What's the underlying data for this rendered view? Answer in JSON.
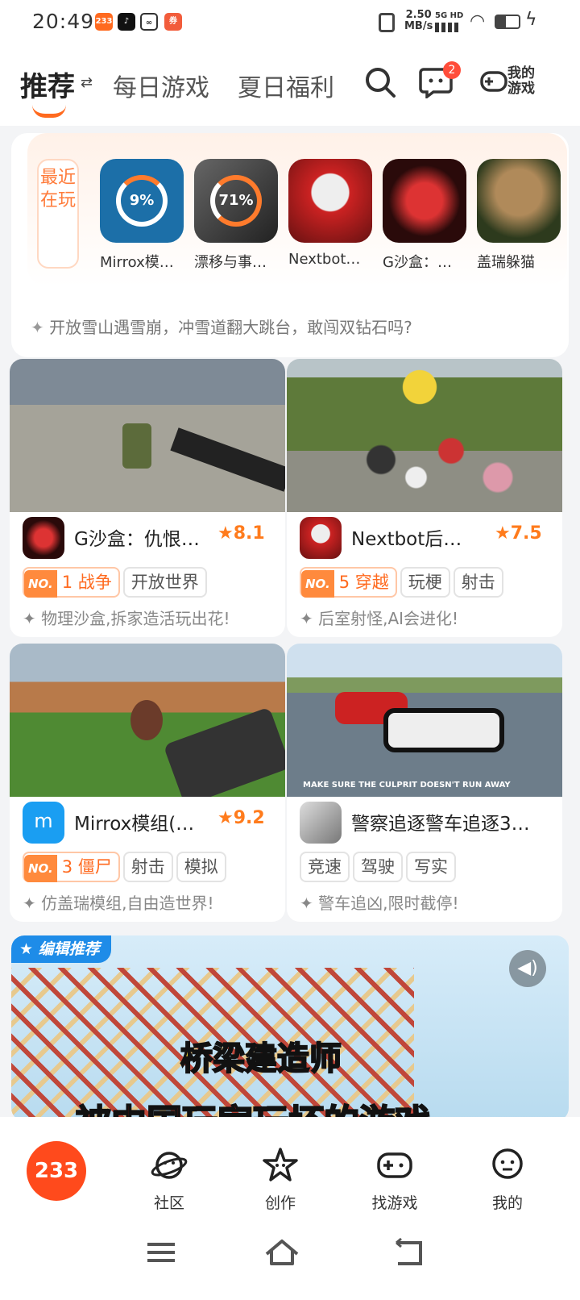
{
  "status_bar": {
    "time": "20:49",
    "net_speed": "2.50",
    "net_unit": "MB/s",
    "signal": "5G HD"
  },
  "tabs": {
    "recommend": "推荐",
    "daily": "每日游戏",
    "summer": "夏日福利",
    "my_games": "我的游戏",
    "msg_badge": "2"
  },
  "recent": {
    "label": "最近在玩",
    "games": [
      {
        "name": "Mirrox模…",
        "progress": "9%"
      },
      {
        "name": "漂移与事…",
        "progress": "71%"
      },
      {
        "name": "Nextbot…",
        "progress": ""
      },
      {
        "name": "G沙盒：…",
        "progress": ""
      },
      {
        "name": "盖瑞躲猫",
        "progress": ""
      }
    ],
    "tip": "开放雪山遇雪崩，冲雪道翻大跳台，敢闯双钻石吗?"
  },
  "cards": [
    {
      "name": "G沙盒：仇恨…",
      "rating": "8.1",
      "rank_no": "1",
      "rank_cat": "战争",
      "tags": [
        "开放世界"
      ],
      "desc": "物理沙盒,拆家造活玩出花!"
    },
    {
      "name": "Nextbot后…",
      "rating": "7.5",
      "rank_no": "5",
      "rank_cat": "穿越",
      "tags": [
        "玩梗",
        "射击"
      ],
      "desc": "后室射怪,AI会进化!"
    },
    {
      "name": "Mirrox模组(…",
      "rating": "9.2",
      "rank_no": "3",
      "rank_cat": "僵尸",
      "tags": [
        "射击",
        "模拟"
      ],
      "desc": "仿盖瑞模组,自由造世界!",
      "icon_letter": "m"
    },
    {
      "name": "警察追逐警车追逐3…",
      "rating": "",
      "tags": [
        "竞速",
        "驾驶",
        "写实"
      ],
      "desc": "警车追凶,限时截停!",
      "banner": "MAKE SURE THE CULPRIT DOESN'T RUN AWAY"
    }
  ],
  "featured": {
    "badge": "编辑推荐",
    "title": "桥梁建造师",
    "subtitle": "被中国玩家玩坏的游戏"
  },
  "nav": {
    "home": "233",
    "community": "社区",
    "create": "创作",
    "find": "找游戏",
    "me": "我的"
  },
  "colors": {
    "accent": "#ff6a1f",
    "star": "#ff7b1c"
  }
}
